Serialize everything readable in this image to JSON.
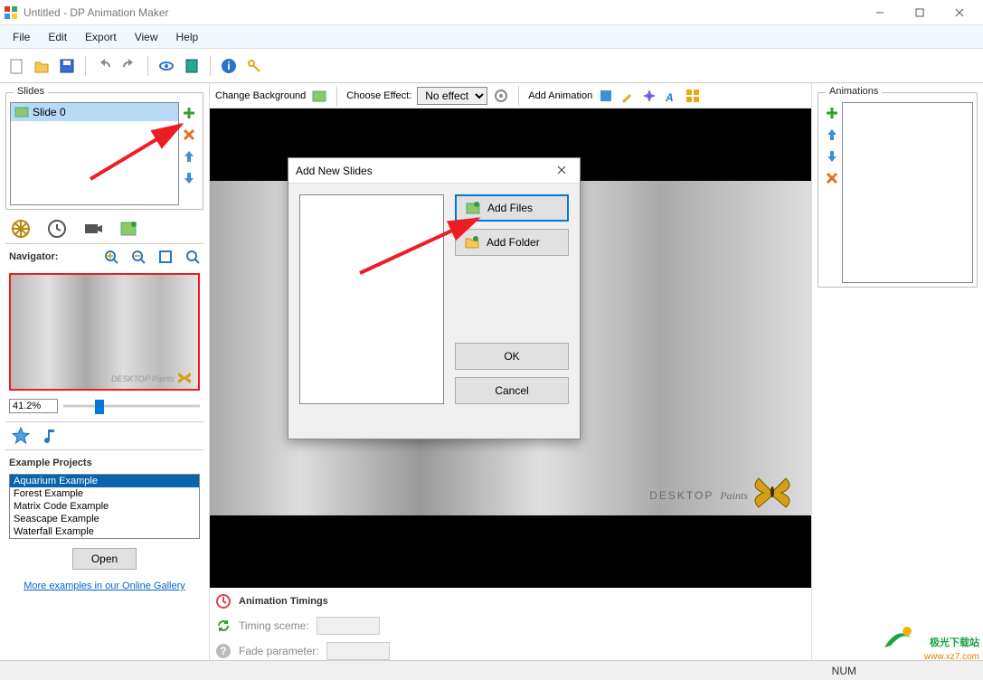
{
  "window": {
    "title": "Untitled - DP Animation Maker"
  },
  "menu": {
    "items": [
      "File",
      "Edit",
      "Export",
      "View",
      "Help"
    ]
  },
  "slides": {
    "group_label": "Slides",
    "items": [
      {
        "label": "Slide 0"
      }
    ]
  },
  "navigator": {
    "label": "Navigator:",
    "zoom_value": "41.2%"
  },
  "examples": {
    "label": "Example Projects",
    "items": [
      "Aquarium Example",
      "Forest Example",
      "Matrix Code Example",
      "Seascape Example",
      "Waterfall Example"
    ],
    "open_label": "Open",
    "link": "More examples in our Online Gallery"
  },
  "centerbar": {
    "change_bg": "Change Background",
    "choose_effect": "Choose Effect:",
    "effect_value": "No effect",
    "add_anim": "Add Animation"
  },
  "timings": {
    "title": "Animation Timings",
    "row1": "Timing sceme:",
    "row2": "Fade parameter:"
  },
  "animations": {
    "group_label": "Animations"
  },
  "dialog": {
    "title": "Add New Slides",
    "add_files": "Add Files",
    "add_folder": "Add Folder",
    "ok": "OK",
    "cancel": "Cancel"
  },
  "status": {
    "num": "NUM"
  },
  "watermark": {
    "text": "DESKTOP Paints"
  },
  "brandmark": {
    "name": "极光下载站",
    "url": "www.xz7.com"
  }
}
